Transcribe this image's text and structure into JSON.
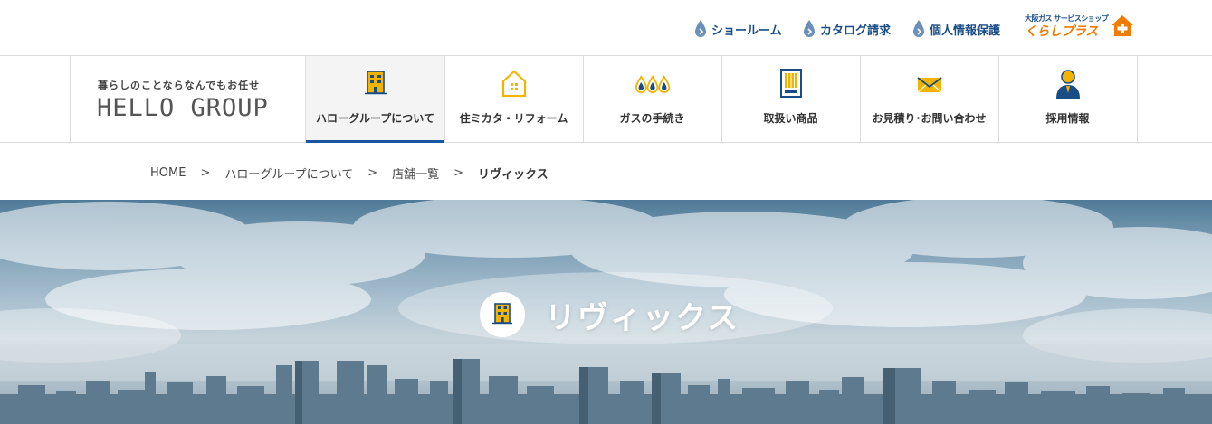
{
  "top_links": [
    {
      "label": "ショールーム",
      "icon": "water-drop-icon"
    },
    {
      "label": "カタログ請求",
      "icon": "water-drop-icon"
    },
    {
      "label": "個人情報保護",
      "icon": "water-drop-icon"
    }
  ],
  "partner_logo": {
    "small": "大阪ガス サービスショップ",
    "big": "くらしプラス"
  },
  "logo": {
    "tagline": "暮らしのことならなんでもお任せ",
    "brand": "HELLO GROUP"
  },
  "nav": [
    {
      "label": "ハローグループについて",
      "icon": "building-icon",
      "active": true
    },
    {
      "label": "住ミカタ・リフォーム",
      "icon": "house-icon",
      "active": false
    },
    {
      "label": "ガスの手続き",
      "icon": "gas-flame-icon",
      "active": false
    },
    {
      "label": "取扱い商品",
      "icon": "appliance-icon",
      "active": false
    },
    {
      "label": "お見積り･お問い合わせ",
      "icon": "envelope-icon",
      "active": false
    },
    {
      "label": "採用情報",
      "icon": "person-icon",
      "active": false
    }
  ],
  "breadcrumb": {
    "items": [
      "HOME",
      "ハローグループについて",
      "店舗一覧"
    ],
    "separator": ">",
    "current": "リヴィックス"
  },
  "hero": {
    "title": "リヴィックス",
    "icon": "building-icon"
  },
  "colors": {
    "brand_blue": "#1a4d86",
    "accent_orange": "#ef7c00",
    "icon_yellow": "#f3b400",
    "active_underline": "#1a55a0"
  }
}
